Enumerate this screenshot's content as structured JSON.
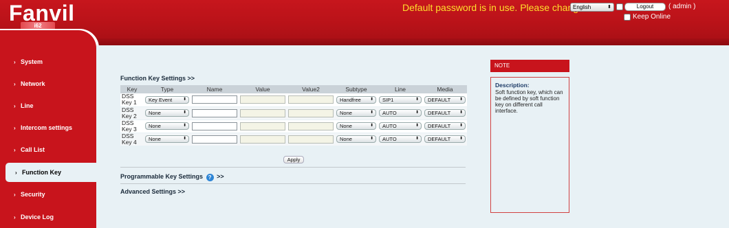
{
  "header": {
    "brand": "Fanvil",
    "model": "i62",
    "warning": "Default password is in use. Please change",
    "language": "English",
    "logout_label": "Logout",
    "user_label": "( admin )",
    "keep_online_label": "Keep Online"
  },
  "sidebar": {
    "items": [
      {
        "label": "System"
      },
      {
        "label": "Network"
      },
      {
        "label": "Line"
      },
      {
        "label": "Intercom settings"
      },
      {
        "label": "Call List"
      },
      {
        "label": "Function Key"
      },
      {
        "label": "Security"
      },
      {
        "label": "Device Log"
      }
    ],
    "active": "Function Key"
  },
  "function_key": {
    "title": "Function Key Settings >>",
    "columns": [
      "Key",
      "Type",
      "Name",
      "Value",
      "Value2",
      "Subtype",
      "Line",
      "Media"
    ],
    "rows": [
      {
        "key": [
          "DSS",
          "Key 1"
        ],
        "type": "Key Event",
        "name": "",
        "value": "",
        "value2": "",
        "subtype": "Handfree",
        "line": "SIP1",
        "media": "DEFAULT"
      },
      {
        "key": [
          "DSS",
          "Key 2"
        ],
        "type": "None",
        "name": "",
        "value": "",
        "value2": "",
        "subtype": "None",
        "line": "AUTO",
        "media": "DEFAULT"
      },
      {
        "key": [
          "DSS",
          "Key 3"
        ],
        "type": "None",
        "name": "",
        "value": "",
        "value2": "",
        "subtype": "None",
        "line": "AUTO",
        "media": "DEFAULT"
      },
      {
        "key": [
          "DSS",
          "Key 4"
        ],
        "type": "None",
        "name": "",
        "value": "",
        "value2": "",
        "subtype": "None",
        "line": "AUTO",
        "media": "DEFAULT"
      }
    ],
    "apply_label": "Apply"
  },
  "programmable": {
    "title": "Programmable Key Settings",
    "suffix": ">>",
    "help": "?"
  },
  "advanced": {
    "title": "Advanced Settings >>"
  },
  "note": {
    "heading": "NOTE",
    "title": "Description:",
    "text": "Soft function key, which can be defined by soft function key on different call interface."
  },
  "colors": {
    "brand_red": "#c8141c",
    "warning_yellow": "#ffdf2c",
    "panel_bg": "#e8f1f5",
    "help_blue": "#2f86d6"
  }
}
